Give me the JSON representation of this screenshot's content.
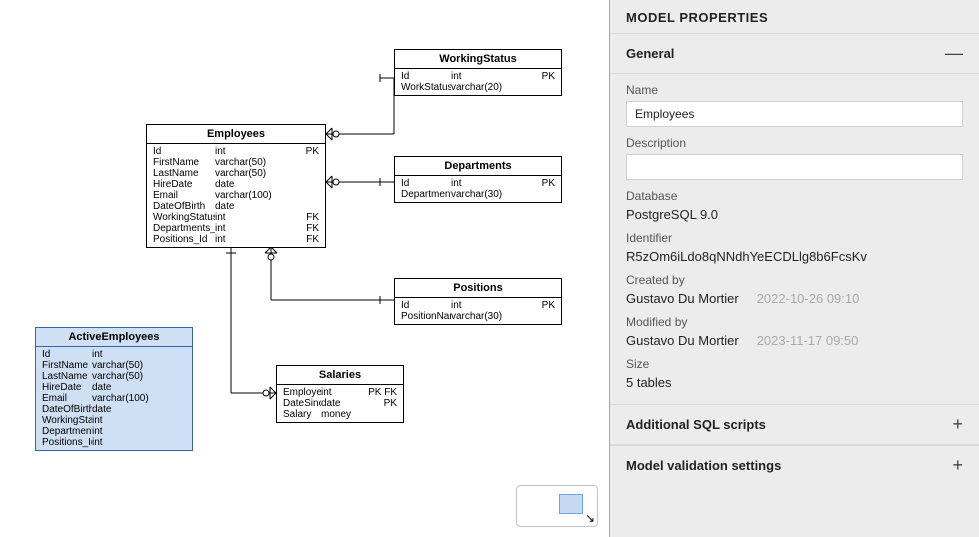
{
  "entities": {
    "workingStatus": {
      "title": "WorkingStatus",
      "rows": [
        {
          "name": "Id",
          "type": "int",
          "key": "PK"
        },
        {
          "name": "WorkStatusDescription",
          "type": "varchar(20)",
          "key": ""
        }
      ]
    },
    "employees": {
      "title": "Employees",
      "rows": [
        {
          "name": "Id",
          "type": "int",
          "key": "PK"
        },
        {
          "name": "FirstName",
          "type": "varchar(50)",
          "key": ""
        },
        {
          "name": "LastName",
          "type": "varchar(50)",
          "key": ""
        },
        {
          "name": "HireDate",
          "type": "date",
          "key": ""
        },
        {
          "name": "Email",
          "type": "varchar(100)",
          "key": ""
        },
        {
          "name": "DateOfBirth",
          "type": "date",
          "key": ""
        },
        {
          "name": "WorkingStatus_Id",
          "type": "int",
          "key": "FK"
        },
        {
          "name": "Departments_Id",
          "type": "int",
          "key": "FK"
        },
        {
          "name": "Positions_Id",
          "type": "int",
          "key": "FK"
        }
      ]
    },
    "departments": {
      "title": "Departments",
      "rows": [
        {
          "name": "Id",
          "type": "int",
          "key": "PK"
        },
        {
          "name": "DepartmentDescrip",
          "type": "varchar(30)",
          "key": ""
        }
      ]
    },
    "positions": {
      "title": "Positions",
      "rows": [
        {
          "name": "Id",
          "type": "int",
          "key": "PK"
        },
        {
          "name": "PositionName",
          "type": "varchar(30)",
          "key": ""
        }
      ]
    },
    "salaries": {
      "title": "Salaries",
      "rows": [
        {
          "name": "Employee_Id",
          "type": "int",
          "key": "PK FK"
        },
        {
          "name": "DateSince",
          "type": "date",
          "key": "PK"
        },
        {
          "name": "Salary",
          "type": "money",
          "key": ""
        }
      ]
    },
    "activeEmployees": {
      "title": "ActiveEmployees",
      "rows": [
        {
          "name": "Id",
          "type": "int",
          "key": ""
        },
        {
          "name": "FirstName",
          "type": "varchar(50)",
          "key": ""
        },
        {
          "name": "LastName",
          "type": "varchar(50)",
          "key": ""
        },
        {
          "name": "HireDate",
          "type": "date",
          "key": ""
        },
        {
          "name": "Email",
          "type": "varchar(100)",
          "key": ""
        },
        {
          "name": "DateOfBirth",
          "type": "date",
          "key": ""
        },
        {
          "name": "WorkingStatus_Id",
          "type": "int",
          "key": ""
        },
        {
          "name": "Departments_Id",
          "type": "int",
          "key": ""
        },
        {
          "name": "Positions_Id",
          "type": "int",
          "key": ""
        }
      ]
    }
  },
  "panel": {
    "title": "MODEL PROPERTIES",
    "sections": {
      "general": {
        "title": "General",
        "name_label": "Name",
        "name_value": "Employees",
        "desc_label": "Description",
        "desc_value": "",
        "db_label": "Database",
        "db_value": "PostgreSQL 9.0",
        "id_label": "Identifier",
        "id_value": "R5zOm6iLdo8qNNdhYeECDLlg8b6FcsKv",
        "created_label": "Created by",
        "created_by": "Gustavo Du Mortier",
        "created_at": "2022-10-26 09:10",
        "modified_label": "Modified by",
        "modified_by": "Gustavo Du Mortier",
        "modified_at": "2023-11-17 09:50",
        "size_label": "Size",
        "size_value": "5 tables"
      },
      "sql": {
        "title": "Additional SQL scripts"
      },
      "validation": {
        "title": "Model validation settings"
      }
    }
  },
  "glyphs": {
    "minus": "—",
    "plus": "+",
    "arrow": "↘"
  }
}
